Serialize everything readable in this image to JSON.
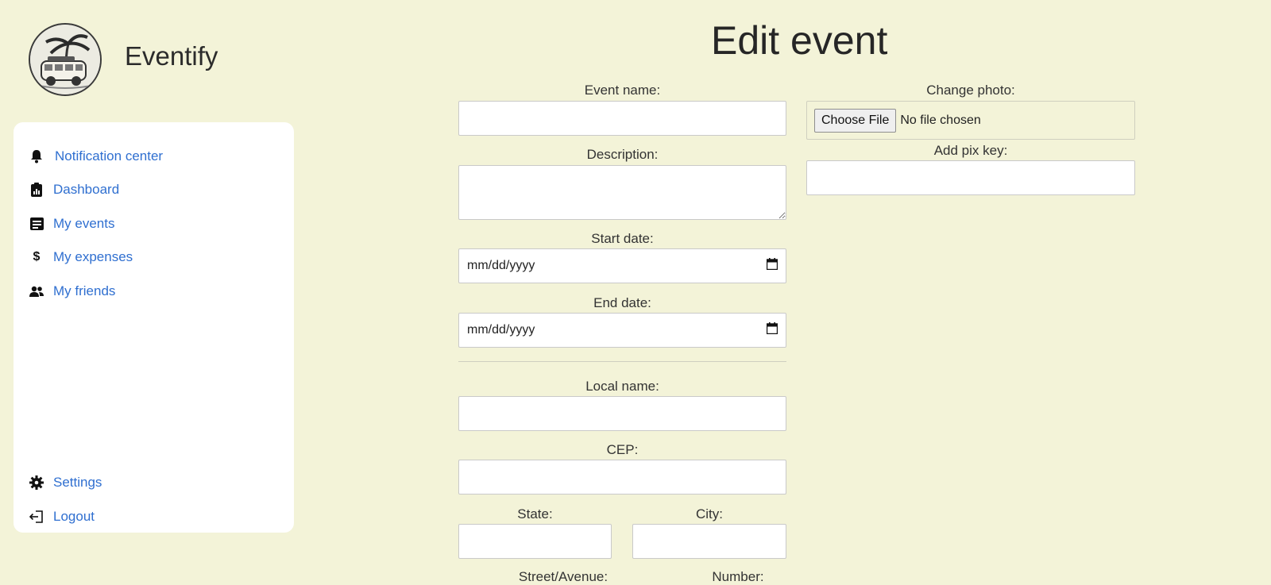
{
  "app": {
    "name": "Eventify"
  },
  "sidebar": {
    "items": [
      {
        "label": "Notification center",
        "icon": "bell-icon"
      },
      {
        "label": "Dashboard",
        "icon": "clipboard-chart-icon"
      },
      {
        "label": "My events",
        "icon": "event-list-icon"
      },
      {
        "label": "My expenses",
        "icon": "dollar-icon"
      },
      {
        "label": "My friends",
        "icon": "people-icon"
      }
    ],
    "bottom_items": [
      {
        "label": "Settings",
        "icon": "gear-icon"
      },
      {
        "label": "Logout",
        "icon": "logout-icon"
      }
    ]
  },
  "page": {
    "title": "Edit event"
  },
  "form": {
    "event_name": {
      "label": "Event name:",
      "value": ""
    },
    "description": {
      "label": "Description:",
      "value": ""
    },
    "start_date": {
      "label": "Start date:",
      "placeholder": "mm/dd/yyyy"
    },
    "end_date": {
      "label": "End date:",
      "placeholder": "mm/dd/yyyy"
    },
    "local_name": {
      "label": "Local name:",
      "value": ""
    },
    "cep": {
      "label": "CEP:",
      "value": ""
    },
    "state": {
      "label": "State:",
      "value": ""
    },
    "city": {
      "label": "City:",
      "value": ""
    },
    "street": {
      "label": "Street/Avenue:"
    },
    "number": {
      "label": "Number:"
    },
    "photo": {
      "label": "Change photo:",
      "button_label": "Choose File",
      "status": "No file chosen"
    },
    "pix_key": {
      "label": "Add pix key:",
      "value": ""
    }
  },
  "colors": {
    "background": "#f3f3d8",
    "link": "#2f6fd0",
    "panel": "#ffffff"
  }
}
